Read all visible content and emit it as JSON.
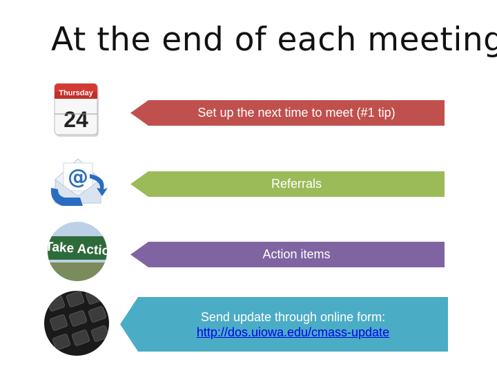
{
  "title": "At the end of each meeting",
  "items": [
    {
      "text": "Set up the next time to meet (#1 tip)",
      "color": "#c0504d",
      "icon": "calendar-icon"
    },
    {
      "text": "Referrals",
      "color": "#9bbb59",
      "icon": "email-icon"
    },
    {
      "text": "Action items",
      "color": "#8064a2",
      "icon": "take-action-icon"
    },
    {
      "text": "Send update through online form:",
      "link": "http://dos.uiowa.edu/cmass-update",
      "color": "#4bacc6",
      "icon": "keyboard-icon"
    }
  ],
  "calendar": {
    "day": "Thursday",
    "date": "24"
  },
  "sign_text": "Take Action"
}
